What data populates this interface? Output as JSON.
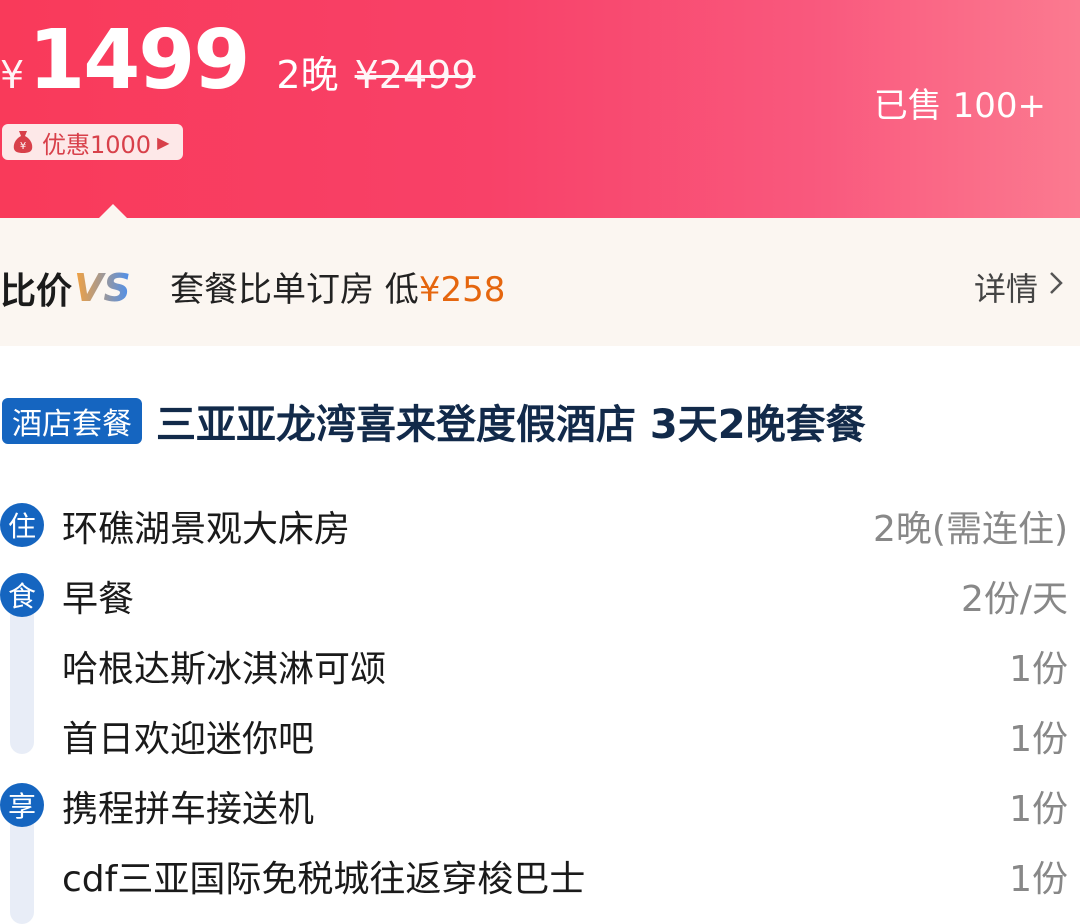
{
  "price": {
    "currency": "¥",
    "amount": "1499",
    "nights": "2晚",
    "original": "¥2499",
    "sold": "已售 100+",
    "discount": "优惠1000"
  },
  "compare": {
    "logo_text": "比价",
    "logo_vs": "VS",
    "text_prefix": "套餐比单订房 低",
    "cheaper_amount": "¥258",
    "detail": "详情"
  },
  "title": {
    "tag": "酒店套餐",
    "text": "三亚亚龙湾喜来登度假酒店 3天2晚套餐"
  },
  "items": [
    {
      "badge": "住",
      "name": "环礁湖景观大床房",
      "qty": "2晚(需连住)"
    },
    {
      "badge": "食",
      "name": "早餐",
      "qty": "2份/天"
    },
    {
      "badge": "",
      "name": "哈根达斯冰淇淋可颂",
      "qty": "1份"
    },
    {
      "badge": "",
      "name": "首日欢迎迷你吧",
      "qty": "1份"
    },
    {
      "badge": "享",
      "name": "携程拼车接送机",
      "qty": "1份"
    },
    {
      "badge": "",
      "name": "cdf三亚国际免税城往返穿梭巴士",
      "qty": "1份"
    }
  ],
  "colors": {
    "banner_start": "#f93a5a",
    "banner_end": "#fb7a90",
    "badge_blue": "#1565c0",
    "cheaper_orange": "#e5660e",
    "title_navy": "#122a4a"
  }
}
